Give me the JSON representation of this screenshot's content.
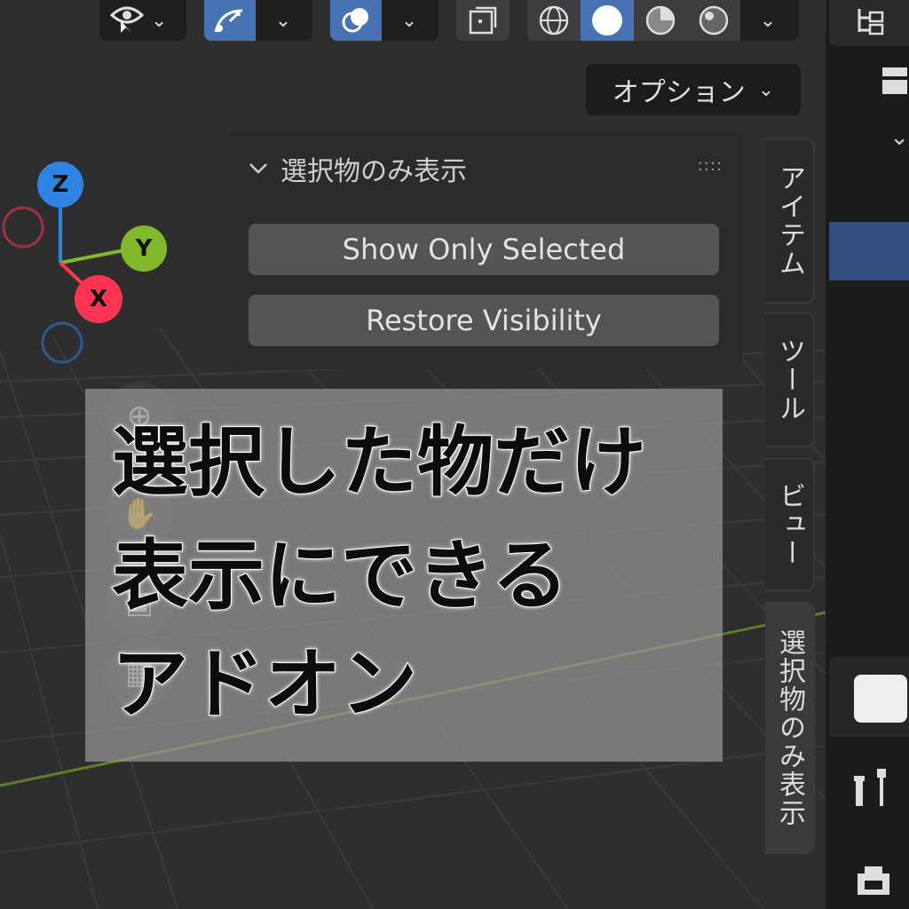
{
  "header": {
    "options_label": "オプション",
    "chevron": "⌄"
  },
  "gizmo": {
    "z_label": "Z",
    "y_label": "Y",
    "x_label": "X",
    "colors": {
      "z": "#2f84e3",
      "y": "#82b92c",
      "x": "#ff3352"
    }
  },
  "panel": {
    "title": "選択物のみ表示",
    "show_only_selected": "Show Only Selected",
    "restore_visibility": "Restore Visibility"
  },
  "side_tabs": [
    {
      "label": "アイテム"
    },
    {
      "label": "ツール"
    },
    {
      "label": "ビュー"
    },
    {
      "label": "選択物のみ表示"
    }
  ],
  "caption": {
    "line1": "選択した物だけ",
    "line2": "表示にできる",
    "line3": "アドオン"
  },
  "colors": {
    "accent": "#4772b3",
    "background": "#2e2e2e",
    "button": "#545454"
  }
}
